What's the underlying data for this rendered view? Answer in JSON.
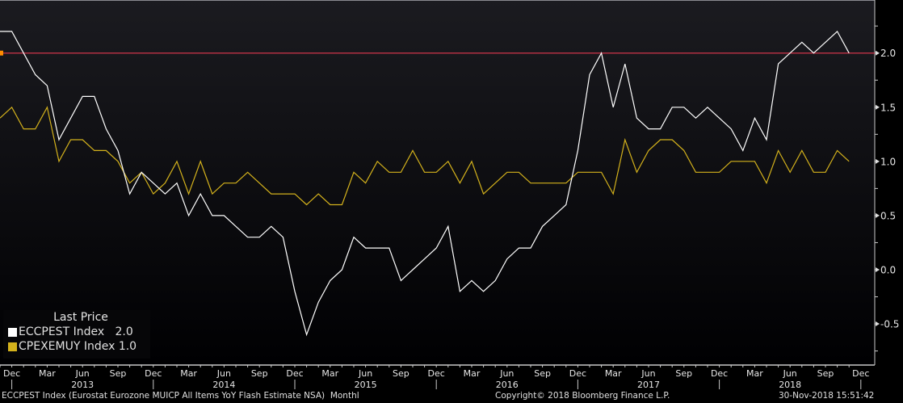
{
  "chart_data": {
    "type": "line",
    "title": "",
    "x_start": "Nov 2012",
    "x_end": "Nov 2018",
    "frequency": "monthly",
    "ylim": [
      -0.88,
      2.49
    ],
    "y_ticks": [
      "2.0",
      "1.5",
      "1.0",
      "0.5",
      "0.0",
      "-0.5"
    ],
    "y_tick_values": [
      2.0,
      1.5,
      1.0,
      0.5,
      0.0,
      -0.5
    ],
    "reference_line": {
      "value": 2.0,
      "color": "#d0344a"
    },
    "x_month_labels": [
      "Dec",
      "Mar",
      "Jun",
      "Sep",
      "Dec",
      "Mar",
      "Jun",
      "Sep",
      "Dec",
      "Mar",
      "Jun",
      "Sep",
      "Dec",
      "Mar",
      "Jun",
      "Sep",
      "Dec",
      "Mar",
      "Jun",
      "Sep",
      "Dec",
      "Mar",
      "Jun",
      "Sep",
      "Dec"
    ],
    "x_year_labels": [
      "2013",
      "2014",
      "2015",
      "2016",
      "2017",
      "2018"
    ],
    "legend_placement": "bottom-left",
    "series": [
      {
        "name": "ECCPEST Index",
        "last": "2.0",
        "color": "#ffffff",
        "values": [
          2.2,
          2.2,
          2.0,
          1.8,
          1.7,
          1.2,
          1.4,
          1.6,
          1.6,
          1.3,
          1.1,
          0.7,
          0.9,
          0.8,
          0.7,
          0.8,
          0.5,
          0.7,
          0.5,
          0.5,
          0.4,
          0.3,
          0.3,
          0.4,
          0.3,
          -0.2,
          -0.6,
          -0.3,
          -0.1,
          0.0,
          0.3,
          0.2,
          0.2,
          0.2,
          -0.1,
          0.0,
          0.1,
          0.2,
          0.4,
          -0.2,
          -0.1,
          -0.2,
          -0.1,
          0.1,
          0.2,
          0.2,
          0.4,
          0.5,
          0.6,
          1.1,
          1.8,
          2.0,
          1.5,
          1.9,
          1.4,
          1.3,
          1.3,
          1.5,
          1.5,
          1.4,
          1.5,
          1.4,
          1.3,
          1.1,
          1.4,
          1.2,
          1.9,
          2.0,
          2.1,
          2.0,
          2.1,
          2.2,
          2.0
        ]
      },
      {
        "name": "CPEXEMUY Index",
        "last": "1.0",
        "color": "#d4b21c",
        "values": [
          1.4,
          1.5,
          1.3,
          1.3,
          1.5,
          1.0,
          1.2,
          1.2,
          1.1,
          1.1,
          1.0,
          0.8,
          0.9,
          0.7,
          0.8,
          1.0,
          0.7,
          1.0,
          0.7,
          0.8,
          0.8,
          0.9,
          0.8,
          0.7,
          0.7,
          0.7,
          0.6,
          0.7,
          0.6,
          0.6,
          0.9,
          0.8,
          1.0,
          0.9,
          0.9,
          1.1,
          0.9,
          0.9,
          1.0,
          0.8,
          1.0,
          0.7,
          0.8,
          0.9,
          0.9,
          0.8,
          0.8,
          0.8,
          0.8,
          0.9,
          0.9,
          0.9,
          0.7,
          1.2,
          0.9,
          1.1,
          1.2,
          1.2,
          1.1,
          0.9,
          0.9,
          0.9,
          1.0,
          1.0,
          1.0,
          0.8,
          1.1,
          0.9,
          1.1,
          0.9,
          0.9,
          1.1,
          1.0
        ]
      }
    ]
  },
  "legend": {
    "title": "Last Price"
  },
  "footer": {
    "description": "ECCPEST Index (Eurostat Eurozone MUICP All Items YoY Flash Estimate NSA)  Monthl",
    "copyright": "Copyright© 2018 Bloomberg Finance L.P.",
    "timestamp": "30-Nov-2018 15:51:42"
  }
}
